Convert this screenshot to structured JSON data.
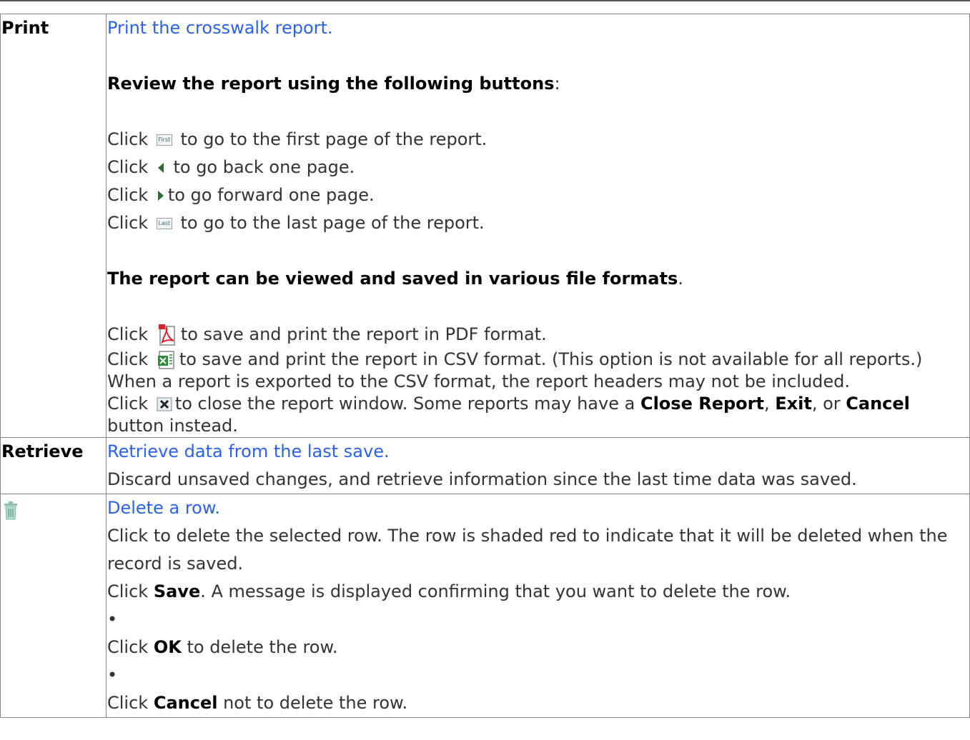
{
  "print_row": {
    "label": "Print",
    "link": "Print the crosswalk report.",
    "review_heading": "Review the report using the following buttons",
    "review_colon": ":",
    "click": "Click",
    "first_btn": "First",
    "first_text": "to go to the first page of the report.",
    "prev_text": "to go back one page.",
    "next_text": "to go forward one page.",
    "last_btn": "Last",
    "last_text": "to go to the last page of the report.",
    "formats_heading": "The report can be viewed and saved in various file formats",
    "formats_period": ".",
    "pdf_text": "to save and print the report in PDF format.",
    "csv_text": "to save and print the report in CSV format. (This option is not available for all reports.) When a report is exported to the CSV format, the report headers may not be included.",
    "close_text_1": "to close the report window. Some reports may have a",
    "close_bold_1": "Close Report",
    "comma": ",",
    "close_bold_2": "Exit",
    "close_or": ", or",
    "close_bold_3": "Cancel",
    "close_text_2": "button instead."
  },
  "retrieve_row": {
    "label": "Retrieve",
    "link": "Retrieve data from the last save.",
    "desc": "Discard unsaved changes, and retrieve information since the last time data was saved."
  },
  "delete_row": {
    "link": "Delete a row.",
    "desc": "Click to delete the selected row. The row is shaded red to indicate that it will be deleted when the record is saved.",
    "click": "Click",
    "save_bold": "Save",
    "save_rest": ". A message is displayed confirming that you want to delete the row.",
    "bullet": "•",
    "ok_bold": "OK",
    "ok_rest": "to delete the row.",
    "cancel_bold": "Cancel",
    "cancel_rest": "not to delete the row."
  }
}
